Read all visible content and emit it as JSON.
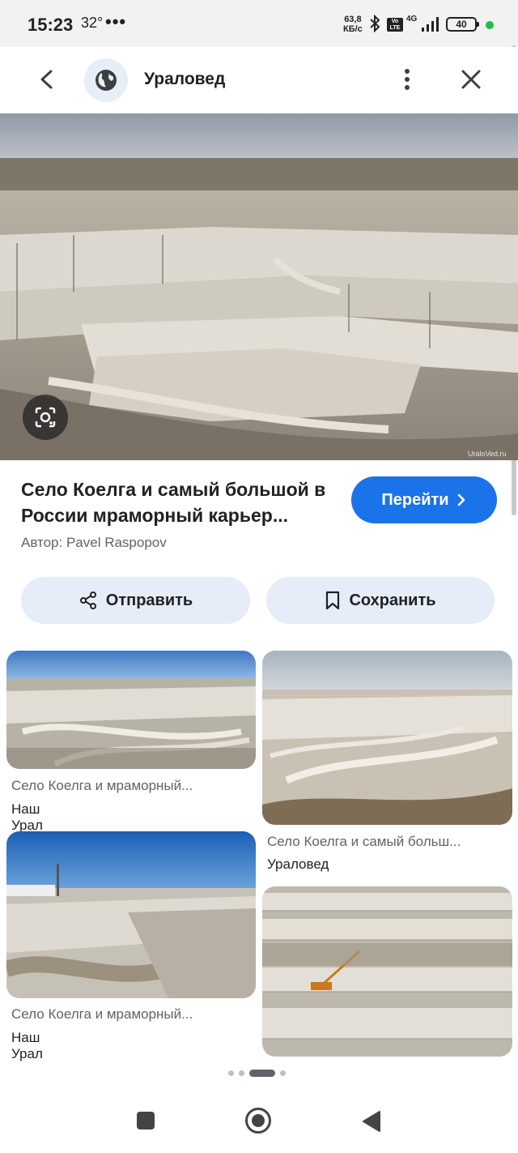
{
  "status_bar": {
    "time": "15:23",
    "temperature": "32°",
    "more": "•••",
    "speed_value": "63,8",
    "speed_unit": "КБ/с",
    "volte": "Vo LTE",
    "network": "4G",
    "battery": "40",
    "indicator_color": "#1fbf4a"
  },
  "header": {
    "site_name": "Ураловед",
    "icons": [
      "chevron-left-icon",
      "globe-icon",
      "more-vert-icon",
      "close-icon"
    ]
  },
  "main": {
    "title": "Село Коелга и самый большой в России мраморный карьер...",
    "author": "Автор: Pavel Raspopov",
    "visit_label": "Перейти",
    "share_label": "Отправить",
    "save_label": "Сохранить",
    "watermark": "UralоVed.ru"
  },
  "related": [
    {
      "title": "Село Коелга и мраморный...",
      "source": "Наш Урал"
    },
    {
      "title": "Село Коелга и самый больш...",
      "source": "Ураловед"
    },
    {
      "title": "Село Коелга и мраморный...",
      "source": "Наш Урал"
    },
    {
      "title": "",
      "source": ""
    }
  ],
  "pagination": {
    "count": 4,
    "active_index": 2
  },
  "colors": {
    "accent": "#1a73e8",
    "chip_bg": "#e6edf8",
    "muted_text": "#5f6368"
  }
}
